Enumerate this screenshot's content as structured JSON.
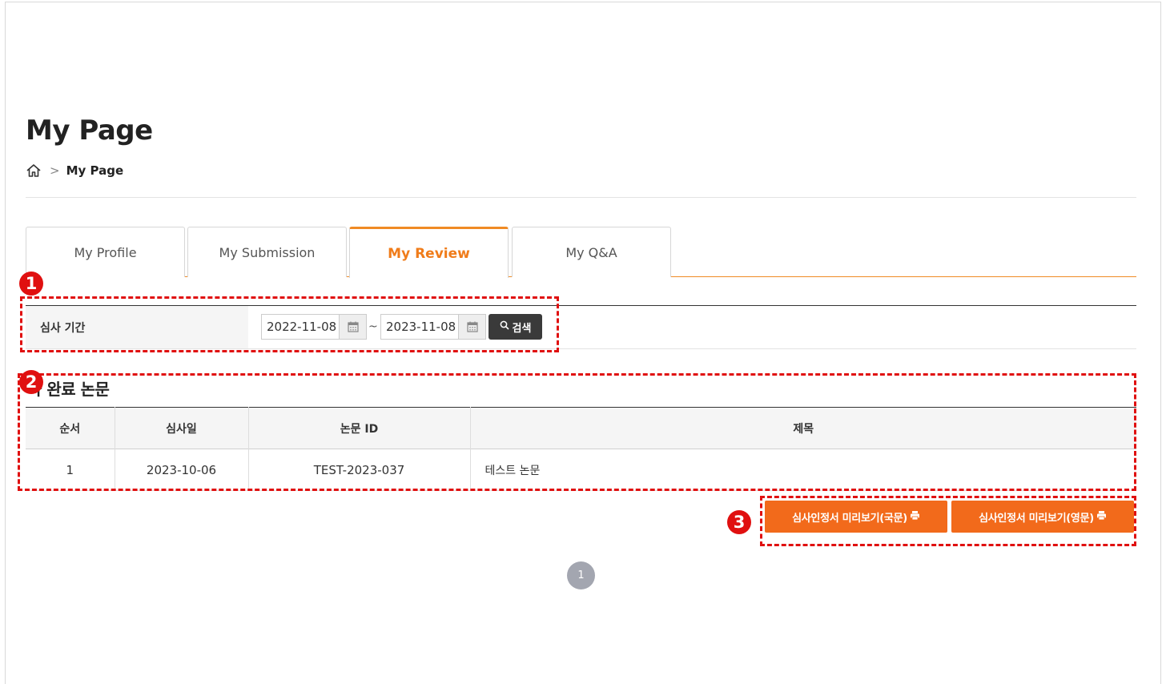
{
  "page": {
    "title": "My Page",
    "breadcrumb": {
      "home_icon": "home-icon",
      "current": "My Page"
    }
  },
  "tabs": [
    {
      "label": "My Profile",
      "active": false
    },
    {
      "label": "My Submission",
      "active": false
    },
    {
      "label": "My Review",
      "active": true
    },
    {
      "label": "My Q&A",
      "active": false
    }
  ],
  "search": {
    "label": "심사 기간",
    "start_date": "2022-11-08",
    "end_date": "2023-11-08",
    "separator": "~",
    "button_label": "검색",
    "calendar_icon": "calendar-icon",
    "search_icon": "search-icon"
  },
  "results": {
    "section_title": "사 완료 논문",
    "columns": [
      "순서",
      "심사일",
      "논문 ID",
      "제목"
    ],
    "rows": [
      {
        "no": "1",
        "date": "2023-10-06",
        "paper_id": "TEST-2023-037",
        "title": "테스트 논문"
      }
    ]
  },
  "actions": {
    "preview_korean": "심사인정서 미리보기(국문)",
    "preview_english": "심사인정서 미리보기(영문)",
    "print_icon": "print-icon"
  },
  "pagination": {
    "current": "1"
  },
  "annotations": {
    "badge_1": "1",
    "badge_2": "2",
    "badge_3": "3",
    "color": "#e01010"
  },
  "colors": {
    "accent": "#f08a24",
    "button_orange": "#f26a1b",
    "dark_button": "#3a3a3a"
  }
}
